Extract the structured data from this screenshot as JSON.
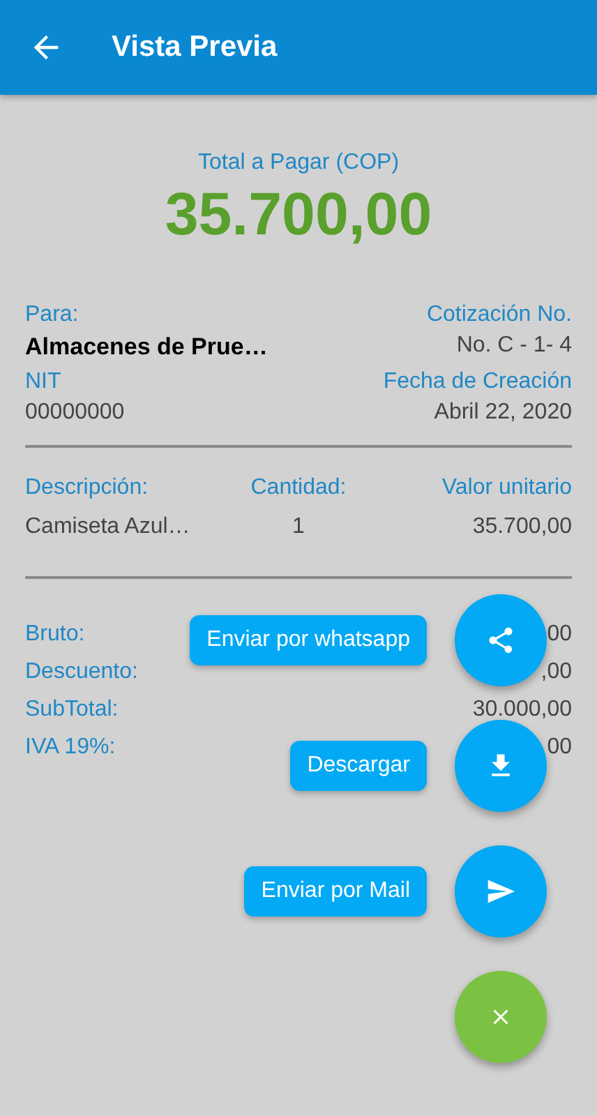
{
  "header": {
    "title": "Vista Previa"
  },
  "total": {
    "label": "Total a Pagar (COP)",
    "amount": "35.700,00"
  },
  "info": [
    {
      "left_label": "Para:",
      "left_value": "Almacenes de Prue…",
      "right_label": "Cotización No.",
      "right_value": "No. C - 1- 4"
    },
    {
      "left_label": "NIT",
      "left_value": "00000000",
      "right_label": "Fecha de Creación",
      "right_value": "Abril 22, 2020"
    }
  ],
  "items": {
    "columns": [
      "Descripción:",
      "Cantidad:",
      "Valor unitario"
    ],
    "rows": [
      [
        "Camiseta Azul…",
        "1",
        "35.700,00"
      ]
    ]
  },
  "totals": [
    {
      "label": "Bruto:",
      "value": "00"
    },
    {
      "label": "Descuento:",
      "value": ",00"
    },
    {
      "label": "SubTotal:",
      "value": "30.000,00"
    },
    {
      "label": "IVA 19%:",
      "value": "00"
    }
  ],
  "actions": [
    {
      "kind": "share",
      "label": "Enviar por whatsapp"
    },
    {
      "kind": "download",
      "label": "Descargar"
    },
    {
      "kind": "send",
      "label": "Enviar por Mail"
    },
    {
      "kind": "close"
    }
  ]
}
